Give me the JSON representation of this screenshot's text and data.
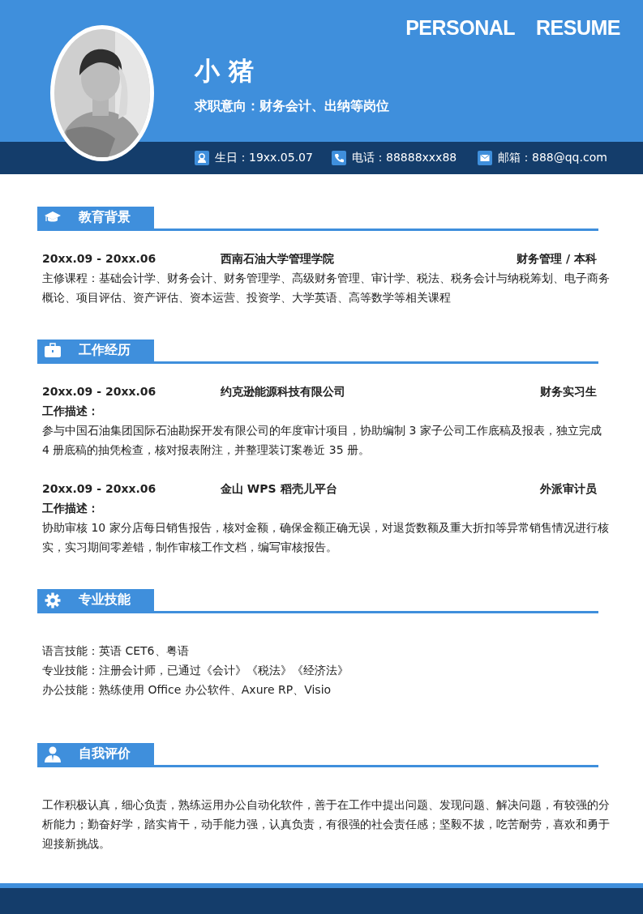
{
  "header": {
    "title_words": [
      "PERSONAL",
      "RESUME"
    ],
    "name": "小 猪",
    "intention": "求职意向：财务会计、出纳等岗位",
    "photo": {
      "kind": "picture"
    },
    "contacts": [
      {
        "kind": "birthday",
        "text": "生日：19xx.05.07"
      },
      {
        "kind": "phone",
        "text": "电话：88888xxx88"
      },
      {
        "kind": "email",
        "text": "邮箱：888@qq.com"
      }
    ]
  },
  "sections": [
    {
      "kind": "education",
      "title": "教育背景",
      "entries": [
        {
          "date": "20xx.09 - 20xx.06",
          "org": "西南石油大学管理学院",
          "role": "财务管理 / 本科",
          "text": "主修课程：基础会计学、财务会计、财务管理学、高级财务管理、审计学、税法、税务会计与纳税筹划、电子商务概论、项目评估、资产评估、资本运营、投资学、大学英语、高等数学等相关课程"
        }
      ]
    },
    {
      "kind": "work",
      "title": "工作经历",
      "entries": [
        {
          "date": "20xx.09 - 20xx.06",
          "org": "约克逊能源科技有限公司",
          "role": "财务实习生",
          "label": "工作描述：",
          "text": "参与中国石油集团国际石油勘探开发有限公司的年度审计项目，协助编制 3 家子公司工作底稿及报表，独立完成 4 册底稿的抽凭检查，核对报表附注，并整理装订案卷近 35 册。"
        },
        {
          "date": "20xx.09 - 20xx.06",
          "org": "金山 WPS 稻壳儿平台",
          "role": "外派审计员",
          "label": "工作描述：",
          "text": "协助审核 10 家分店每日销售报告，核对金额，确保金额正确无误，对退货数额及重大折扣等异常销售情况进行核实，实习期间零差错，制作审核工作文档，编写审核报告。"
        }
      ]
    },
    {
      "kind": "skills",
      "title": "专业技能",
      "lines": [
        "语言技能：英语 CET6、粤语",
        "专业技能：注册会计师，已通过《会计》《税法》《经济法》",
        "办公技能：熟练使用 Office  办公软件、Axure RP、Visio"
      ]
    },
    {
      "kind": "self",
      "title": "自我评价",
      "text": "工作积极认真，细心负责，熟练运用办公自动化软件，善于在工作中提出问题、发现问题、解决问题，有较强的分析能力；勤奋好学，踏实肯干，动手能力强，认真负责，有很强的社会责任感；坚毅不拔，吃苦耐劳，喜欢和勇于迎接新挑战。"
    }
  ]
}
